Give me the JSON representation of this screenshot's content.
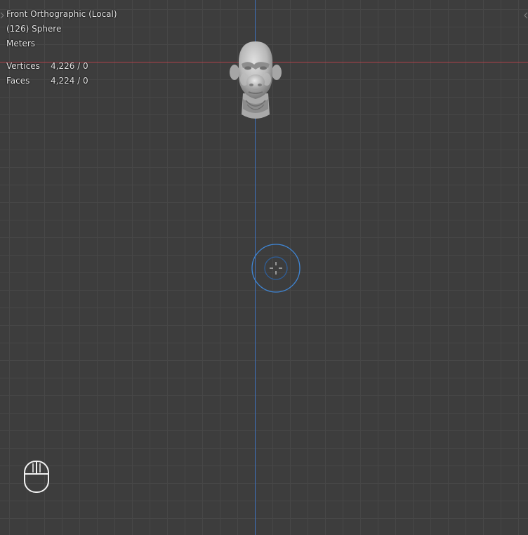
{
  "viewport": {
    "view_name": "Front Orthographic (Local)",
    "object_info": "(126) Sphere",
    "units": "Meters",
    "stats": [
      {
        "label": "Vertices",
        "value": "4,226 / 0"
      },
      {
        "label": "Faces",
        "value": "4,224 / 0"
      }
    ]
  },
  "colors": {
    "background": "#3d3d3d",
    "grid_line": "#474747",
    "x_axis": "#b0414a",
    "z_axis": "#3e70b8",
    "cursor_ring": "#3f86d6",
    "overlay_text": "#e6e6e6"
  },
  "icons": {
    "cursor": "3d-cursor-icon",
    "mouse": "mouse-icon",
    "left_toggle": "chevron-left-icon",
    "right_toggle": "chevron-right-icon"
  }
}
